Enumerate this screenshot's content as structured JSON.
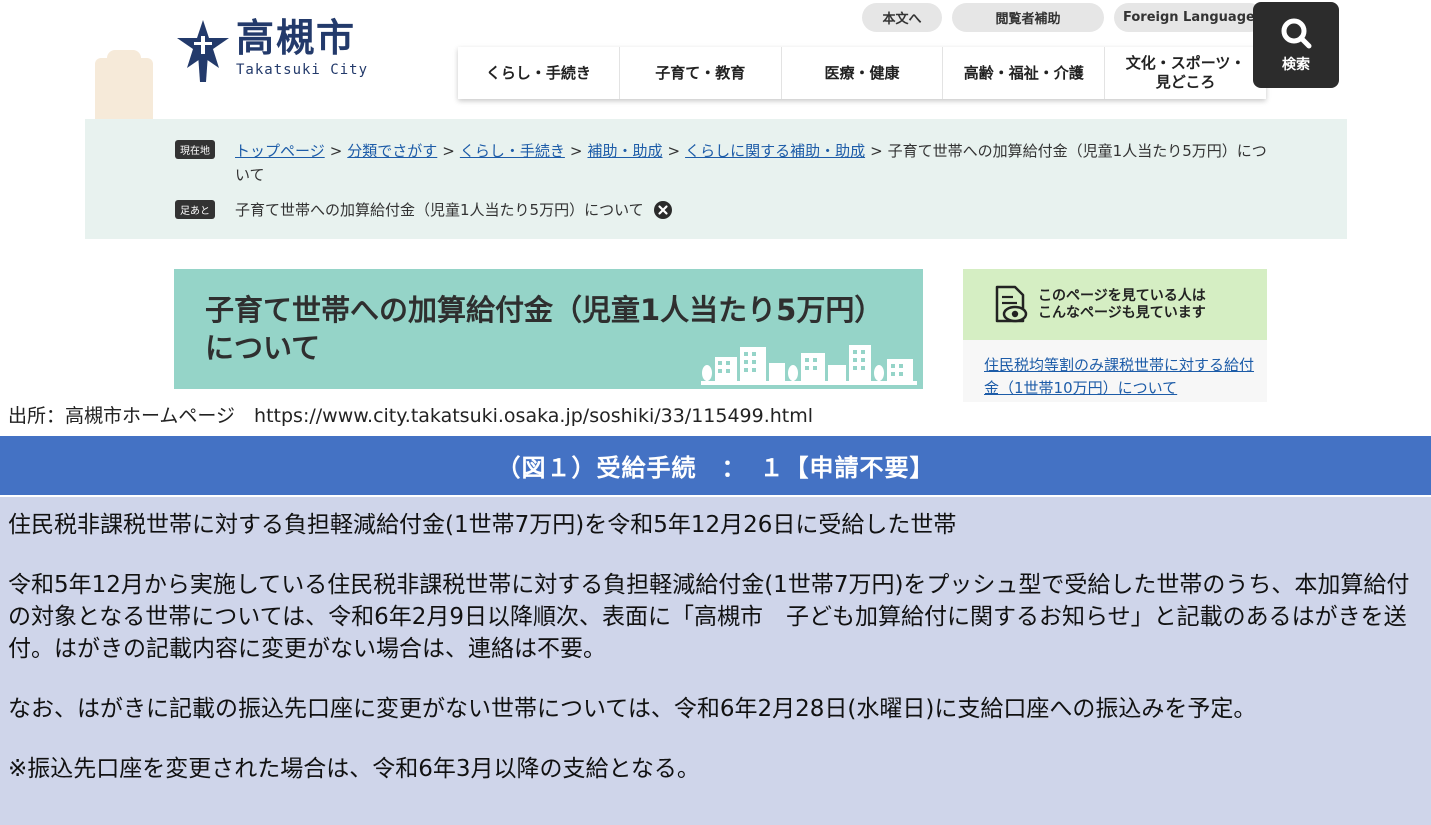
{
  "header": {
    "logo_name": "高槻市",
    "logo_roman": "Takatsuki City",
    "utility_links": {
      "main_content": "本文へ",
      "reader_assist": "閲覧者補助",
      "foreign_language": "Foreign Language"
    },
    "search_label": "検索",
    "global_nav": [
      {
        "label": "くらし・手続き"
      },
      {
        "label": "子育て・教育"
      },
      {
        "label": "医療・健康"
      },
      {
        "label": "高齢・福祉・介護"
      },
      {
        "label": "文化・スポーツ・見どころ"
      }
    ]
  },
  "breadcrumb": {
    "current_tag": "現在地",
    "links": [
      "トップページ",
      "分類でさがす",
      "くらし・手続き",
      "補助・助成",
      "くらしに関する補助・助成"
    ],
    "separator": ">",
    "current": "子育て世帯への加算給付金（児童1人当たり5万円）について",
    "footprint_tag": "足あと",
    "footprint_item": "子育て世帯への加算給付金（児童1人当たり5万円）について"
  },
  "page": {
    "title": "子育て世帯への加算給付金（児童1人当たり5万円）について"
  },
  "related": {
    "title_line1": "このページを見ている人は",
    "title_line2": "こんなページも見ています",
    "link": "住民税均等割のみ課税世帯に対する給付金（1世帯10万円）について"
  },
  "source": "出所：高槻市ホームページ　https://www.city.takatsuki.osaka.jp/soshiki/33/115499.html",
  "figure": {
    "heading": "（図１）受給手続　：　１【申請不要】",
    "paragraphs": [
      "住民税非課税世帯に対する負担軽減給付金(1世帯7万円)を令和5年12月26日に受給した世帯",
      "令和5年12月から実施している住民税非課税世帯に対する負担軽減給付金(1世帯7万円)をプッシュ型で受給した世帯のうち、本加算給付の対象となる世帯については、令和6年2月9日以降順次、表面に「高槻市　子ども加算給付に関するお知らせ」と記載のあるはがきを送付。はがきの記載内容に変更がない場合は、連絡は不要。",
      "なお、はがきに記載の振込先口座に変更がない世帯については、令和6年2月28日(水曜日)に支給口座への振込みを予定。",
      "※振込先口座を変更された場合は、令和6年3月以降の支給となる。"
    ]
  },
  "colors": {
    "logo": "#233a6b",
    "breadcrumb_bg": "#e8f2ef",
    "title_bg": "#95d4c8",
    "related_head_bg": "#d5eec3",
    "link": "#1d5ca8",
    "figure_head_bg": "#4472c4",
    "figure_body_bg": "#cfd5ea"
  }
}
